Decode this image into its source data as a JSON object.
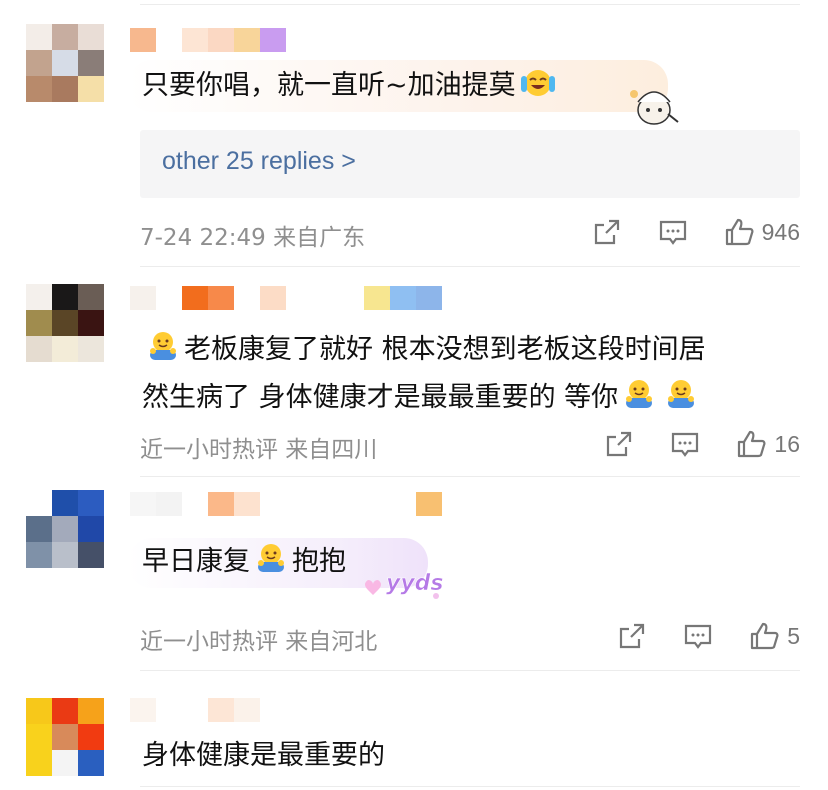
{
  "colors": {
    "replies_link": "#4b6fa0",
    "meta_gray": "#8f8f8f",
    "reply_box_bg": "#f5f5f6",
    "divider": "#ececec"
  },
  "comments": [
    {
      "text": "只要你唱，就一直听~加油提莫",
      "emoji": "laughing-crying-emoji",
      "sticker": "paimon-sticker",
      "replies_label": "other 25 replies >",
      "meta": "7-24 22:49 来自广东",
      "likes": "946"
    },
    {
      "text_line1": "老板康复了就好 根本没想到老板这段时间居",
      "text_line2": "然生病了 身体健康才是最最重要的 等你",
      "emoji": "hug-emoji",
      "meta": "近一小时热评 来自四川",
      "likes": "16"
    },
    {
      "text_part1": "早日康复",
      "text_part2": "抱抱",
      "emoji": "hug-emoji",
      "sticker": "yyds-sticker",
      "meta": "近一小时热评 来自河北",
      "likes": "5"
    },
    {
      "text": "身体健康是最重要的"
    }
  ],
  "icons": {
    "share": "share-icon",
    "comment": "comment-icon",
    "like": "thumbs-up-icon"
  }
}
